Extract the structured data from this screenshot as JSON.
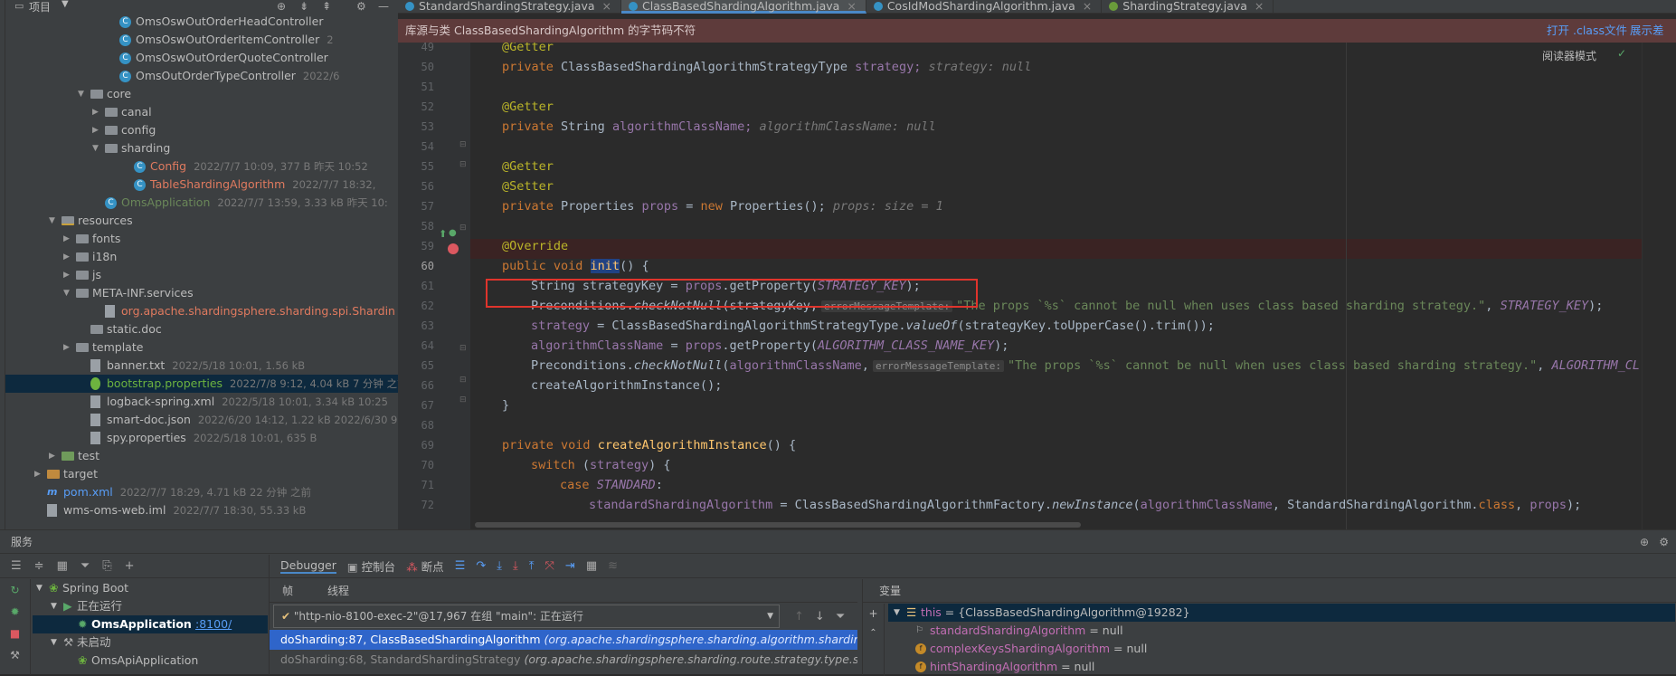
{
  "project_panel": {
    "title": "项目",
    "tree": [
      {
        "label": "OmsOswOutOrderHeadController",
        "meta": "",
        "kind": "class",
        "depth": 7
      },
      {
        "label": "OmsOswOutOrderItemController",
        "meta": "2",
        "kind": "class",
        "depth": 7
      },
      {
        "label": "OmsOswOutOrderQuoteController",
        "meta": "",
        "kind": "class",
        "depth": 7
      },
      {
        "label": "OmsOutOrderTypeController",
        "meta": "2022/6",
        "kind": "class",
        "depth": 7
      },
      {
        "label": "core",
        "meta": "",
        "kind": "folder-open",
        "depth": 5
      },
      {
        "label": "canal",
        "meta": "",
        "kind": "folder-closed",
        "depth": 6
      },
      {
        "label": "config",
        "meta": "",
        "kind": "folder-closed",
        "depth": 6
      },
      {
        "label": "sharding",
        "meta": "",
        "kind": "folder-open",
        "depth": 6
      },
      {
        "label": "Config",
        "meta": "2022/7/7 10:09, 377 B 昨天 10:52",
        "kind": "class-red",
        "depth": 8
      },
      {
        "label": "TableShardingAlgorithm",
        "meta": "2022/7/7 18:32,",
        "kind": "class-red",
        "depth": 8
      },
      {
        "label": "OmsApplication",
        "meta": "2022/7/7 13:59, 3.33 kB 昨天 10:",
        "kind": "class-green",
        "depth": 6
      },
      {
        "label": "resources",
        "meta": "",
        "kind": "resources-open",
        "depth": 3
      },
      {
        "label": "fonts",
        "meta": "",
        "kind": "folder-closed",
        "depth": 4
      },
      {
        "label": "i18n",
        "meta": "",
        "kind": "folder-closed",
        "depth": 4
      },
      {
        "label": "js",
        "meta": "",
        "kind": "folder-closed",
        "depth": 4
      },
      {
        "label": "META-INF.services",
        "meta": "",
        "kind": "folder-open",
        "depth": 4
      },
      {
        "label": "org.apache.shardingsphere.sharding.spi.Shardin",
        "meta": "",
        "kind": "file-red",
        "depth": 6
      },
      {
        "label": "static.doc",
        "meta": "",
        "kind": "folder",
        "depth": 5
      },
      {
        "label": "template",
        "meta": "",
        "kind": "folder-closed",
        "depth": 4
      },
      {
        "label": "banner.txt",
        "meta": "2022/5/18 10:01, 1.56 kB",
        "kind": "file",
        "depth": 5
      },
      {
        "label": "bootstrap.properties",
        "meta": "2022/7/8 9:12, 4.04 kB 7 分钟 之前",
        "kind": "props",
        "depth": 5,
        "selected": true
      },
      {
        "label": "logback-spring.xml",
        "meta": "2022/5/18 10:01, 3.34 kB 10:25",
        "kind": "file",
        "depth": 5
      },
      {
        "label": "smart-doc.json",
        "meta": "2022/6/20 14:12, 1.22 kB 2022/6/30 9:07",
        "kind": "file",
        "depth": 5
      },
      {
        "label": "spy.properties",
        "meta": "2022/5/18 10:01, 635 B",
        "kind": "file",
        "depth": 5
      },
      {
        "label": "test",
        "meta": "",
        "kind": "test-closed",
        "depth": 3
      },
      {
        "label": "target",
        "meta": "",
        "kind": "target-closed",
        "depth": 2
      },
      {
        "label": "pom.xml",
        "meta": "2022/7/7 18:29, 4.71 kB 22 分钟 之前",
        "kind": "maven",
        "depth": 2
      },
      {
        "label": "wms-oms-web.iml",
        "meta": "2022/7/7 18:30, 55.33 kB",
        "kind": "file",
        "depth": 2
      }
    ]
  },
  "tabs": [
    {
      "label": "StandardShardingStrategy.java",
      "active": false
    },
    {
      "label": "ClassBasedShardingAlgorithm.java",
      "active": true
    },
    {
      "label": "CosIdModShardingAlgorithm.java",
      "active": false
    },
    {
      "label": "ShardingStrategy.java",
      "active": false
    }
  ],
  "banner": {
    "text": "库源与类 ClassBasedShardingAlgorithm 的字节码不符",
    "action1": "打开 .class文件",
    "action2": "展示差"
  },
  "reader_mode": "阅读器模式",
  "editor": {
    "line_numbers": [
      "49",
      "50",
      "51",
      "52",
      "53",
      "54",
      "55",
      "56",
      "57",
      "58",
      "59",
      "60",
      "61",
      "62",
      "63",
      "64",
      "65",
      "66",
      "67",
      "68",
      "69",
      "70",
      "71",
      "72"
    ],
    "l49": "@Getter",
    "l50_kw": "private",
    "l50_type": "ClassBasedShardingAlgorithmStrategyType",
    "l50_field": "strategy;",
    "l50_hint": "strategy: null",
    "l52": "@Getter",
    "l53_kw": "private",
    "l53_type": "String",
    "l53_field": "algorithmClassName;",
    "l53_hint": "algorithmClassName: null",
    "l55": "@Getter",
    "l56": "@Setter",
    "l57_kw": "private",
    "l57_type": "Properties",
    "l57_field": "props",
    "l57_rest": "= ",
    "l57_new": "new",
    "l57_end": "Properties();",
    "l57_hint": "props:  size = 1",
    "l59": "@Override",
    "l60_kw": "public void",
    "l60_fn": "init",
    "l60_end": "() {",
    "l61_a": "String strategyKey = ",
    "l61_b": "props",
    "l61_c": ".getProperty(",
    "l61_d": "STRATEGY_KEY",
    "l61_e": ");",
    "l62_a": "Preconditions.",
    "l62_b": "checkNotNull",
    "l62_c": "(strategyKey,",
    "l62_ph": "errorMessageTemplate:",
    "l62_str": "\"The props `%s` cannot be null when uses class based sharding strategy.\"",
    "l62_d": ",",
    "l62_e": "STRATEGY_KEY",
    "l62_f": ");",
    "l63_a": "strategy",
    "l63_b": " = ClassBasedShardingAlgorithmStrategyType.",
    "l63_c": "valueOf",
    "l63_d": "(strategyKey.toUpperCase().trim());",
    "l64_a": "algorithmClassName",
    "l64_b": " = ",
    "l64_c": "props",
    "l64_d": ".getProperty(",
    "l64_e": "ALGORITHM_CLASS_NAME_KEY",
    "l64_f": ");",
    "l65_a": "Preconditions.",
    "l65_b": "checkNotNull",
    "l65_c": "(",
    "l65_d": "algorithmClassName",
    "l65_e": ",",
    "l65_ph": "errorMessageTemplate:",
    "l65_str": "\"The props `%s` cannot be null when uses class based sharding strategy.\"",
    "l65_f": ",",
    "l65_g": "ALGORITHM_CL",
    "l66": "createAlgorithmInstance();",
    "l67": "}",
    "l69_kw": "private void",
    "l69_fn": "createAlgorithmInstance",
    "l69_end": "() {",
    "l70_kw": "switch",
    "l70_a": " (",
    "l70_b": "strategy",
    "l70_c": ") {",
    "l71_kw": "case",
    "l71_b": "STANDARD",
    "l71_c": ":",
    "l72_a": "standardShardingAlgorithm",
    "l72_b": " = ClassBasedShardingAlgorithmFactory.",
    "l72_c": "newInstance",
    "l72_d": "(",
    "l72_e": "algorithmClassName",
    "l72_f": ", StandardShardingAlgorithm.",
    "l72_g": "class",
    "l72_h": ", ",
    "l72_i": "props",
    "l72_j": ");"
  },
  "services": {
    "title": "服务",
    "tree": [
      {
        "label": "Spring Boot",
        "depth": 0
      },
      {
        "label": "正在运行",
        "depth": 1
      },
      {
        "label": "OmsApplication",
        "port": ":8100/",
        "depth": 2,
        "selected": true
      },
      {
        "label": "未启动",
        "depth": 1
      },
      {
        "label": "OmsApiApplication",
        "depth": 2
      }
    ]
  },
  "debugger": {
    "tabs": [
      "Debugger",
      "控制台",
      "断点"
    ],
    "frames_label": "帧",
    "threads_label": "线程",
    "thread_select": "\"http-nio-8100-exec-2\"@17,967 在组 \"main\": 正在运行",
    "frames": [
      {
        "method": "doSharding:87, ClassBasedShardingAlgorithm",
        "pkg": "(org.apache.shardingsphere.sharding.algorithm.sharding.class",
        "current": true
      },
      {
        "method": "doSharding:68, StandardShardingStrategy",
        "pkg": "(org.apache.shardingsphere.sharding.route.strategy.type.standard",
        "current": false
      }
    ],
    "variables_label": "变量",
    "variables": [
      {
        "name": "this",
        "value": " = {ClassBasedShardingAlgorithm@19282}",
        "expanded": true
      },
      {
        "name": "standardShardingAlgorithm",
        "value": " = null"
      },
      {
        "name": "complexKeysShardingAlgorithm",
        "value": " = null"
      },
      {
        "name": "hintShardingAlgorithm",
        "value": " = null"
      }
    ]
  }
}
